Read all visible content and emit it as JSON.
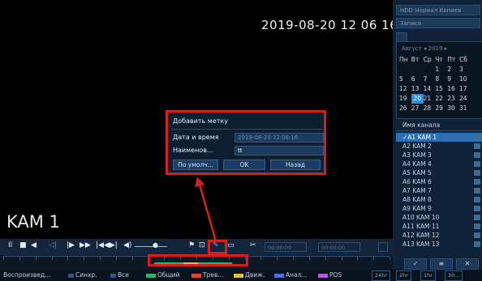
{
  "video": {
    "osd_time": "2019-08-20 12 06 16",
    "camera_label": "KAM 1"
  },
  "right_panel": {
    "field1": "HDD Нормал Копиев",
    "field2": "Записи",
    "cal_month": "Август  ◂  2019 ▸",
    "cal_header": [
      "Пн",
      "Вт",
      "Ср",
      "Чт",
      "Пт",
      "Сб"
    ],
    "cal_rows": [
      [
        "",
        "",
        "",
        "1",
        "2",
        "3"
      ],
      [
        "5",
        "6",
        "7",
        "8",
        "9",
        "10"
      ],
      [
        "12",
        "13",
        "14",
        "15",
        "16",
        "17"
      ],
      [
        "19",
        "20",
        "21",
        "22",
        "23",
        "24"
      ],
      [
        "26",
        "27",
        "28",
        "29",
        "30",
        "31"
      ]
    ],
    "selected_day": "20",
    "channel_header": "Имя канала",
    "channels": [
      {
        "label": "✓A1 KAM 1",
        "active": true
      },
      {
        "label": "A2 KAM 2",
        "active": false
      },
      {
        "label": "A3 KAM 3",
        "active": false
      },
      {
        "label": "A4 KAM 4",
        "active": false
      },
      {
        "label": "A5 KAM 5",
        "active": false
      },
      {
        "label": "A6 KAM 6",
        "active": false
      },
      {
        "label": "A7 KAM 7",
        "active": false
      },
      {
        "label": "A8 KAM 8",
        "active": false
      },
      {
        "label": "A9 KAM 9",
        "active": false
      },
      {
        "label": "A10 KAM 10",
        "active": false
      },
      {
        "label": "A11 KAM 11",
        "active": false
      },
      {
        "label": "A12 KAM 12",
        "active": false
      },
      {
        "label": "A13 KAM 13",
        "active": false
      }
    ],
    "btn_icons": [
      "✓",
      "≡",
      "✕"
    ]
  },
  "playback": {
    "controls": [
      "II",
      "■",
      "◀",
      "◁|",
      "|▶",
      "▶▶",
      "|◀◀▶|",
      "◀)",
      "●",
      "⚑",
      "⊡",
      "✎",
      "▭",
      "✂"
    ],
    "time_start": "00:00:00",
    "time_end": "00:00:00"
  },
  "dialog": {
    "title": "Добавить метку",
    "date_label": "Дата и время",
    "date_value": "2019-08-20 12:06:16",
    "name_label": "Наименов...",
    "name_value": "tt",
    "btn_default": "По умолч...",
    "btn_ok": "OK",
    "btn_back": "Назад"
  },
  "status": {
    "playback": "Воспроизвед...",
    "sync": "Синхр.",
    "all": "Все",
    "general": "Общий",
    "alarm": "Трев...",
    "motion": "Движ.",
    "analytics": "Анал...",
    "pos": "POS",
    "zoom": [
      "24hr",
      "2hr",
      "1hr",
      "30..."
    ]
  },
  "colors": {
    "highlight": "#d81f1f",
    "general": "#2fb36a",
    "alarm": "#e0432f",
    "motion": "#e0c23a",
    "analytics": "#4a74d8",
    "pos": "#b45ad8"
  }
}
